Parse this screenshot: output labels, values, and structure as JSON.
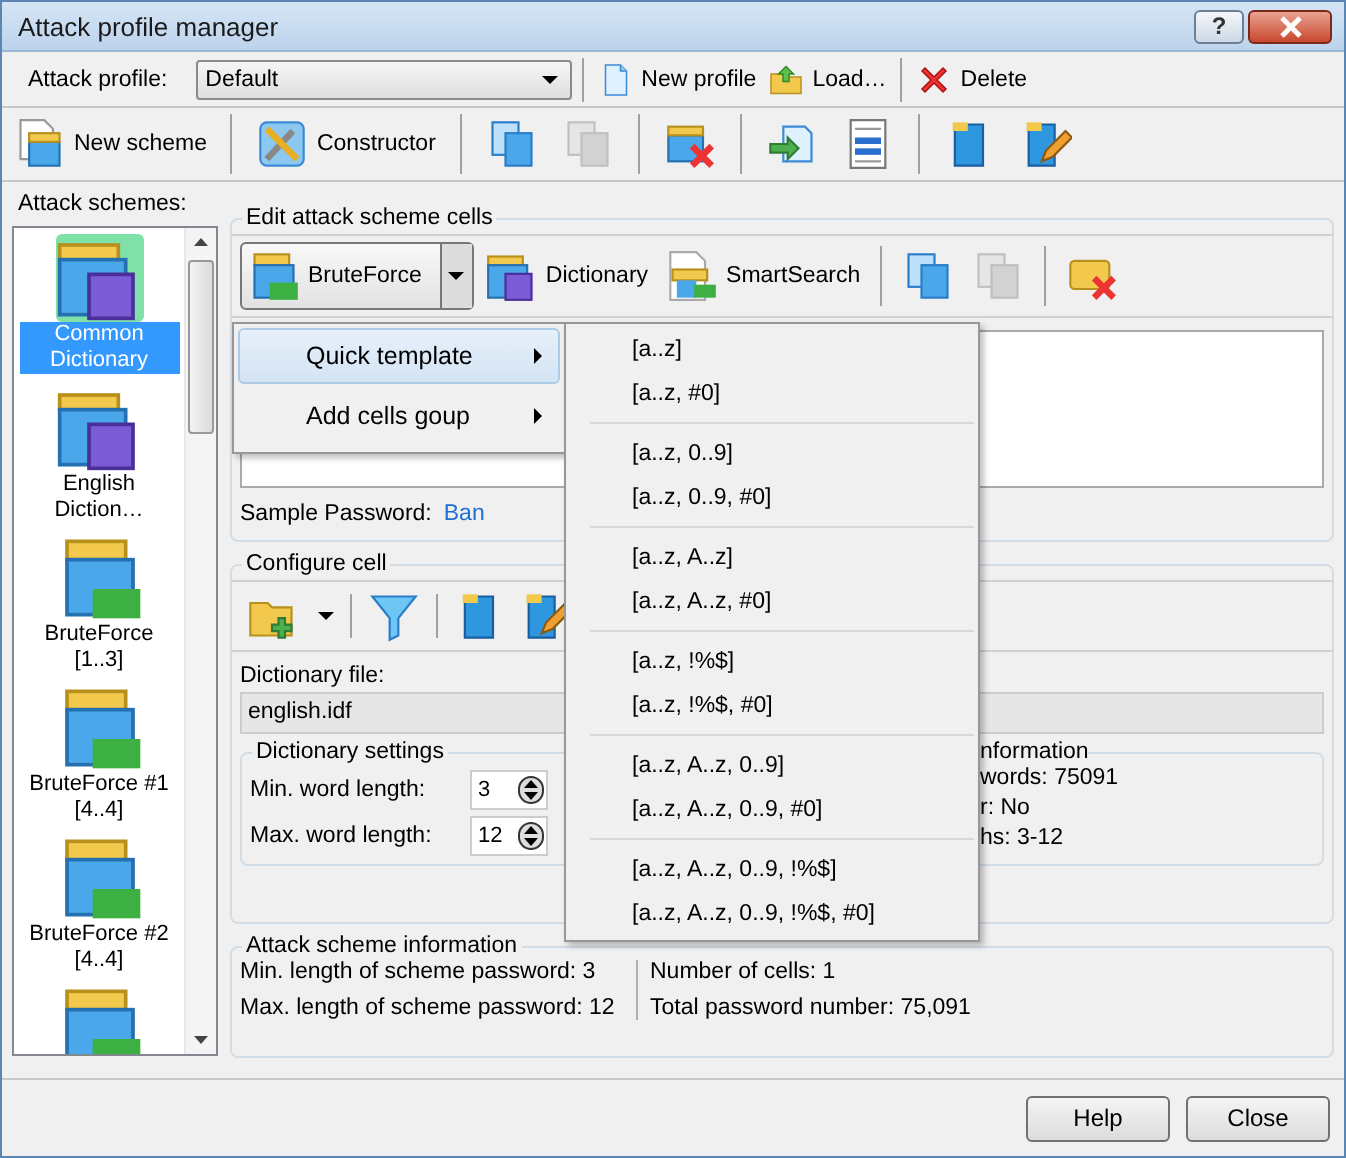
{
  "window": {
    "title": "Attack profile manager",
    "help_button": "?"
  },
  "profile_bar": {
    "label": "Attack profile:",
    "profile": "Default",
    "groups": [
      [
        {
          "kind": "new",
          "label": "New profile",
          "disabled": false
        },
        {
          "kind": "load",
          "label": "Load…",
          "disabled": false
        }
      ],
      [
        {
          "kind": "delete",
          "label": "Delete",
          "disabled": false
        }
      ]
    ]
  },
  "scheme_toolbar": {
    "groups": [
      [
        {
          "kind": "new-scheme",
          "label": "New scheme",
          "disabled": false
        }
      ],
      [
        {
          "kind": "constructor",
          "label": "Constructor",
          "disabled": false
        }
      ],
      [
        {
          "kind": "copy",
          "disabled": false
        },
        {
          "kind": "paste",
          "disabled": true
        }
      ],
      [
        {
          "kind": "remove",
          "disabled": false
        }
      ],
      [
        {
          "kind": "import",
          "disabled": false
        },
        {
          "kind": "list",
          "disabled": false
        }
      ],
      [
        {
          "kind": "book",
          "disabled": false
        },
        {
          "kind": "book-edit",
          "disabled": false
        }
      ]
    ]
  },
  "schemes": {
    "label": "Attack schemes:",
    "items": [
      {
        "kind": "dictionary",
        "name": "Common Dictionary",
        "selected": true
      },
      {
        "kind": "dictionary",
        "name": "English Diction…",
        "selected": false
      },
      {
        "kind": "bruteforce",
        "name": "BruteForce [1..3]",
        "selected": false
      },
      {
        "kind": "bruteforce",
        "name": "BruteForce #1 [4..4]",
        "selected": false
      },
      {
        "kind": "bruteforce",
        "name": "BruteForce #2 [4..4]",
        "selected": false
      },
      {
        "kind": "bruteforce",
        "selected": false
      }
    ]
  },
  "edit_cells": {
    "title": "Edit attack scheme cells",
    "groups": [
      [
        {
          "kind": "bruteforce",
          "label": "BruteForce",
          "pressed": true,
          "dropdown": true,
          "disabled": false
        },
        {
          "kind": "dictionary",
          "label": "Dictionary",
          "pressed": false,
          "dropdown": false,
          "disabled": false
        },
        {
          "kind": "smartsearch",
          "label": "SmartSearch",
          "pressed": false,
          "dropdown": false,
          "disabled": false
        }
      ],
      [
        {
          "kind": "copy",
          "pressed": false,
          "dropdown": false,
          "disabled": false
        },
        {
          "kind": "paste",
          "pressed": false,
          "dropdown": false,
          "disabled": true
        }
      ],
      [
        {
          "kind": "remove-cell",
          "pressed": false,
          "dropdown": false,
          "disabled": false
        }
      ]
    ],
    "sample_password": {
      "label": "Sample Password:",
      "value": "Ban"
    }
  },
  "configure_cell": {
    "title": "Configure cell",
    "groups": [
      [
        {
          "kind": "folder-add",
          "dropdown": true,
          "disabled": false
        }
      ],
      [
        {
          "kind": "filter",
          "dropdown": false,
          "disabled": false
        }
      ],
      [
        {
          "kind": "book",
          "dropdown": false,
          "disabled": false
        },
        {
          "kind": "book-edit",
          "dropdown": false,
          "disabled": false
        }
      ]
    ],
    "dictionary_file": {
      "label": "Dictionary file:",
      "value": "english.idf"
    },
    "settings": {
      "title": "Dictionary settings",
      "fields": [
        {
          "label": "Min. word length:",
          "value": "3"
        },
        {
          "label": "Max. word length:",
          "value": "12"
        }
      ]
    },
    "information": {
      "title": "nformation",
      "lines": [
        "words: 75091",
        "r: No",
        "hs: 3-12"
      ]
    }
  },
  "scheme_info": {
    "title": "Attack scheme information",
    "left": [
      "Min. length of scheme password: 3",
      "Max. length of scheme password: 12"
    ],
    "right": [
      "Number of cells: 1",
      "Total password number: 75,091"
    ]
  },
  "buttons": [
    "Help",
    "Close"
  ],
  "menu": {
    "items": [
      {
        "label": "Quick template",
        "selected": true,
        "submenu": true
      },
      {
        "label": "Add cells goup",
        "selected": false,
        "submenu": true
      }
    ],
    "submenu": {
      "groups": [
        [
          "[a..z]",
          "[a..z, #0]"
        ],
        [
          "[a..z, 0..9]",
          "[a..z, 0..9, #0]"
        ],
        [
          "[a..z, A..z]",
          "[a..z, A..z, #0]"
        ],
        [
          "[a..z, !%$]",
          "[a..z, !%$, #0]"
        ],
        [
          "[a..z, A..z, 0..9]",
          "[a..z, A..z, 0..9, #0]"
        ],
        [
          "[a..z, A..z, 0..9, !%$]",
          "[a..z, A..z, 0..9, !%$, #0]"
        ]
      ]
    }
  }
}
